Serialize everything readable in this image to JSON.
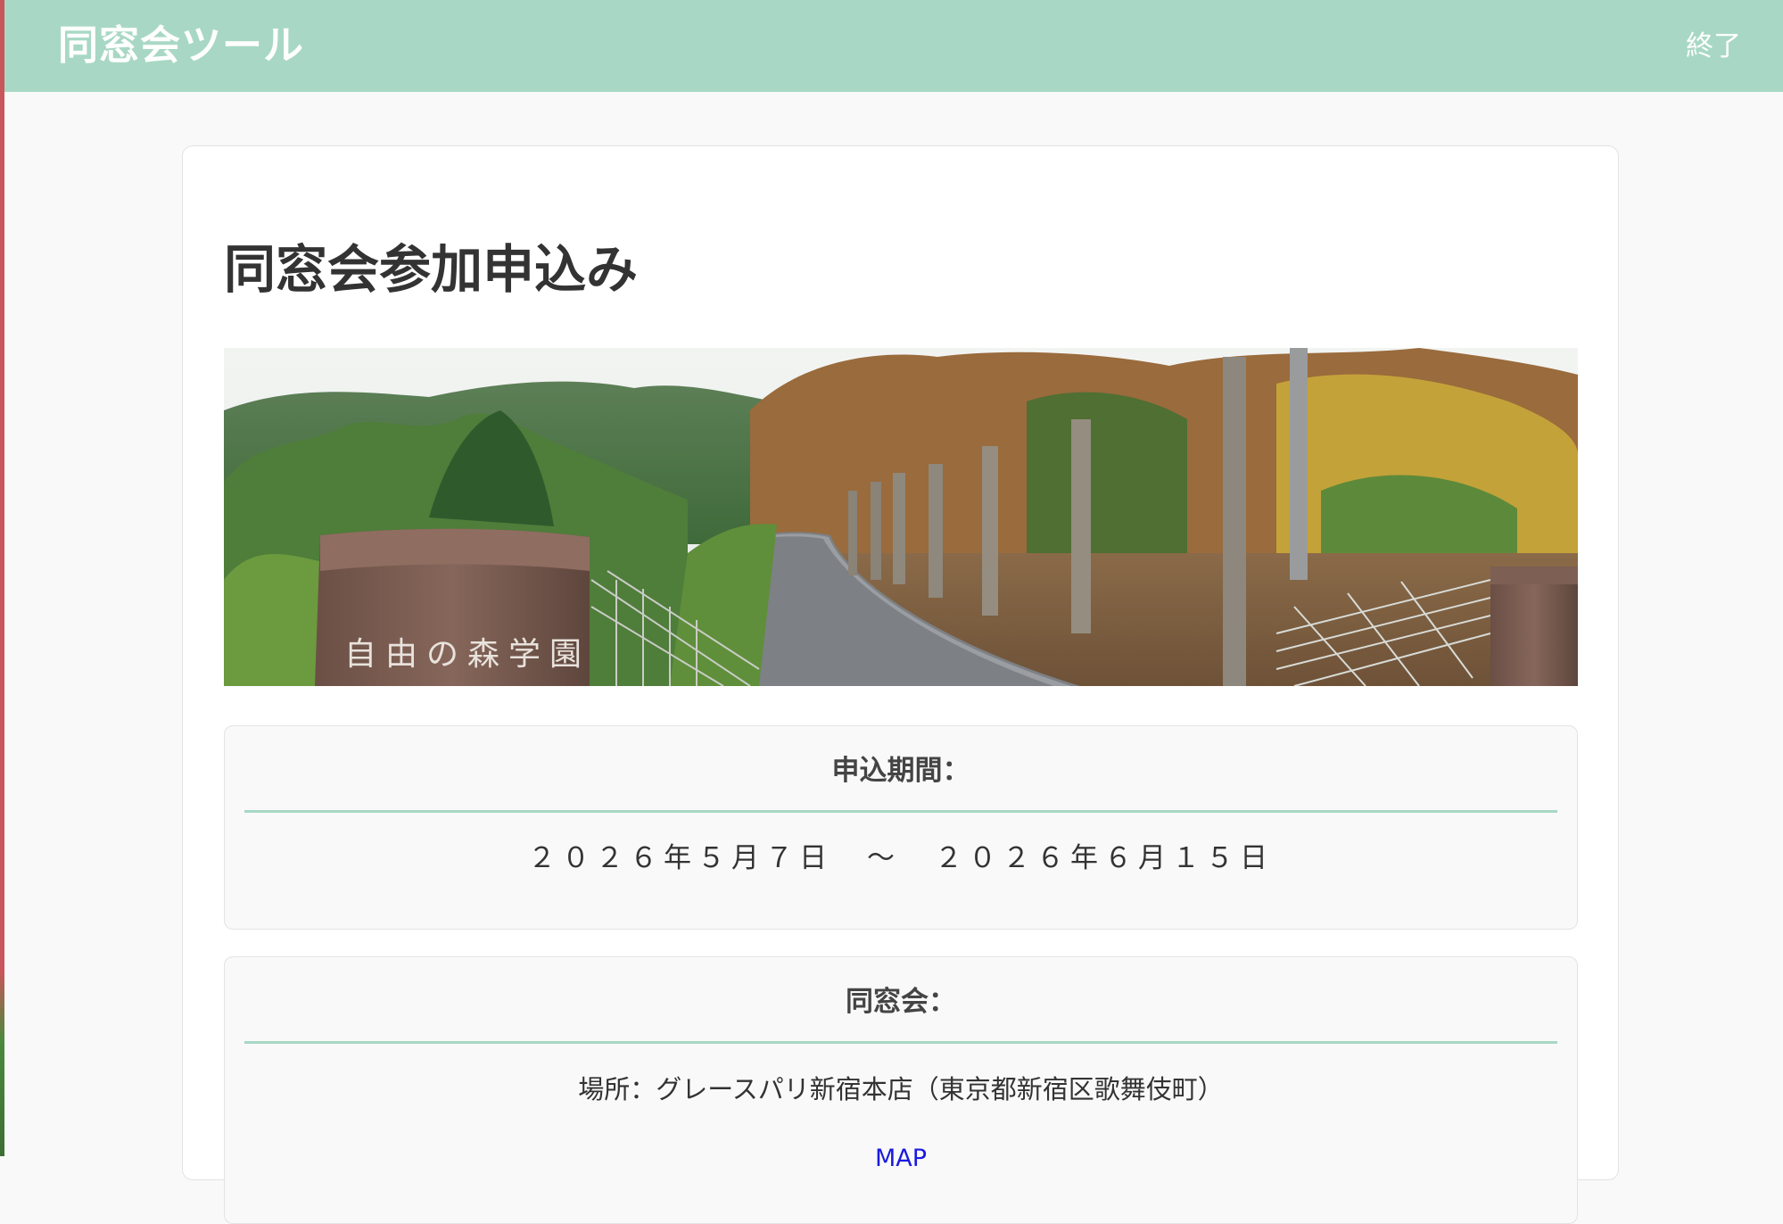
{
  "header": {
    "app_title": "同窓会ツール",
    "exit_label": "終了"
  },
  "main": {
    "page_title": "同窓会参加申込み",
    "banner": {
      "gate_sign": "自由の森学園"
    },
    "period": {
      "heading": "申込期間：",
      "value": "２０２６年５月７日　～　２０２６年６月１５日"
    },
    "reunion": {
      "heading": "同窓会：",
      "place": "場所：グレースパリ新宿本店（東京都新宿区歌舞伎町）",
      "map_link": "MAP"
    }
  },
  "colors": {
    "header_bg": "#a8d8c5",
    "accent_rule": "#a8d8c5",
    "link": "#1a1ae0"
  }
}
